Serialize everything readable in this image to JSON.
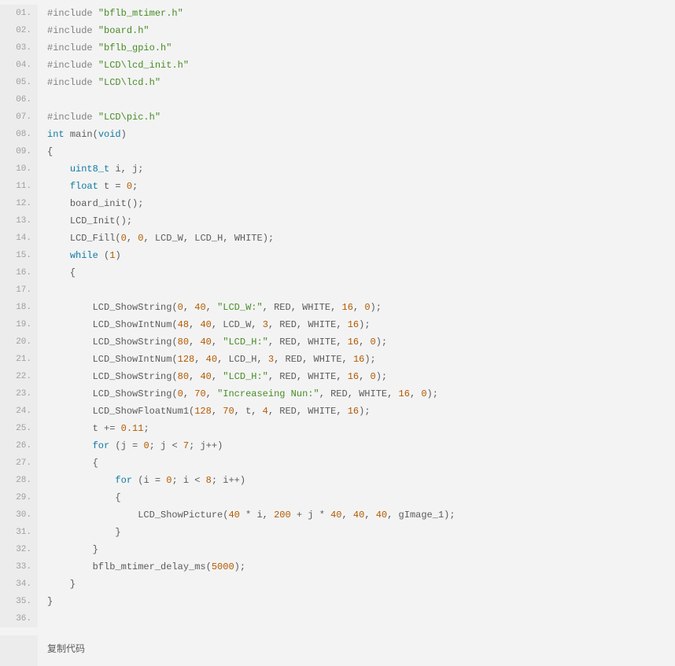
{
  "copy_label": "复制代码",
  "lines": [
    {
      "n": "01.",
      "t": [
        [
          "builtin",
          "#include"
        ],
        [
          "punc",
          " "
        ],
        [
          "string",
          "\"bflb_mtimer.h\""
        ]
      ]
    },
    {
      "n": "02.",
      "t": [
        [
          "builtin",
          "#include"
        ],
        [
          "punc",
          " "
        ],
        [
          "string",
          "\"board.h\""
        ]
      ]
    },
    {
      "n": "03.",
      "t": [
        [
          "builtin",
          "#include"
        ],
        [
          "punc",
          " "
        ],
        [
          "string",
          "\"bflb_gpio.h\""
        ]
      ]
    },
    {
      "n": "04.",
      "t": [
        [
          "builtin",
          "#include"
        ],
        [
          "punc",
          " "
        ],
        [
          "string",
          "\"LCD\\lcd_init.h\""
        ]
      ]
    },
    {
      "n": "05.",
      "t": [
        [
          "builtin",
          "#include"
        ],
        [
          "punc",
          " "
        ],
        [
          "string",
          "\"LCD\\lcd.h\""
        ]
      ]
    },
    {
      "n": "06.",
      "t": []
    },
    {
      "n": "07.",
      "t": [
        [
          "builtin",
          "#include"
        ],
        [
          "punc",
          " "
        ],
        [
          "string",
          "\"LCD\\pic.h\""
        ]
      ]
    },
    {
      "n": "08.",
      "t": [
        [
          "keyword",
          "int"
        ],
        [
          "punc",
          " "
        ],
        [
          "ident",
          "main"
        ],
        [
          "punc",
          "("
        ],
        [
          "keyword",
          "void"
        ],
        [
          "punc",
          ")"
        ]
      ]
    },
    {
      "n": "09.",
      "t": [
        [
          "punc",
          "{"
        ]
      ]
    },
    {
      "n": "10.",
      "t": [
        [
          "punc",
          "    "
        ],
        [
          "type",
          "uint8_t"
        ],
        [
          "punc",
          " "
        ],
        [
          "ident",
          "i"
        ],
        [
          "punc",
          ", "
        ],
        [
          "ident",
          "j"
        ],
        [
          "punc",
          ";"
        ]
      ]
    },
    {
      "n": "11.",
      "t": [
        [
          "punc",
          "    "
        ],
        [
          "keyword",
          "float"
        ],
        [
          "punc",
          " "
        ],
        [
          "ident",
          "t"
        ],
        [
          "punc",
          " = "
        ],
        [
          "number",
          "0"
        ],
        [
          "punc",
          ";"
        ]
      ]
    },
    {
      "n": "12.",
      "t": [
        [
          "punc",
          "    "
        ],
        [
          "ident",
          "board_init"
        ],
        [
          "punc",
          "();"
        ]
      ]
    },
    {
      "n": "13.",
      "t": [
        [
          "punc",
          "    "
        ],
        [
          "ident",
          "LCD_Init"
        ],
        [
          "punc",
          "();"
        ]
      ]
    },
    {
      "n": "14.",
      "t": [
        [
          "punc",
          "    "
        ],
        [
          "ident",
          "LCD_Fill"
        ],
        [
          "punc",
          "("
        ],
        [
          "number",
          "0"
        ],
        [
          "punc",
          ", "
        ],
        [
          "number",
          "0"
        ],
        [
          "punc",
          ", "
        ],
        [
          "ident",
          "LCD_W"
        ],
        [
          "punc",
          ", "
        ],
        [
          "ident",
          "LCD_H"
        ],
        [
          "punc",
          ", "
        ],
        [
          "ident",
          "WHITE"
        ],
        [
          "punc",
          ");"
        ]
      ]
    },
    {
      "n": "15.",
      "t": [
        [
          "punc",
          "    "
        ],
        [
          "keyword",
          "while"
        ],
        [
          "punc",
          " ("
        ],
        [
          "number",
          "1"
        ],
        [
          "punc",
          ")"
        ]
      ]
    },
    {
      "n": "16.",
      "t": [
        [
          "punc",
          "    {"
        ]
      ]
    },
    {
      "n": "17.",
      "t": []
    },
    {
      "n": "18.",
      "t": [
        [
          "punc",
          "        "
        ],
        [
          "ident",
          "LCD_ShowString"
        ],
        [
          "punc",
          "("
        ],
        [
          "number",
          "0"
        ],
        [
          "punc",
          ", "
        ],
        [
          "number",
          "40"
        ],
        [
          "punc",
          ", "
        ],
        [
          "string",
          "\"LCD_W:\""
        ],
        [
          "punc",
          ", "
        ],
        [
          "ident",
          "RED"
        ],
        [
          "punc",
          ", "
        ],
        [
          "ident",
          "WHITE"
        ],
        [
          "punc",
          ", "
        ],
        [
          "number",
          "16"
        ],
        [
          "punc",
          ", "
        ],
        [
          "number",
          "0"
        ],
        [
          "punc",
          ");"
        ]
      ]
    },
    {
      "n": "19.",
      "t": [
        [
          "punc",
          "        "
        ],
        [
          "ident",
          "LCD_ShowIntNum"
        ],
        [
          "punc",
          "("
        ],
        [
          "number",
          "48"
        ],
        [
          "punc",
          ", "
        ],
        [
          "number",
          "40"
        ],
        [
          "punc",
          ", "
        ],
        [
          "ident",
          "LCD_W"
        ],
        [
          "punc",
          ", "
        ],
        [
          "number",
          "3"
        ],
        [
          "punc",
          ", "
        ],
        [
          "ident",
          "RED"
        ],
        [
          "punc",
          ", "
        ],
        [
          "ident",
          "WHITE"
        ],
        [
          "punc",
          ", "
        ],
        [
          "number",
          "16"
        ],
        [
          "punc",
          ");"
        ]
      ]
    },
    {
      "n": "20.",
      "t": [
        [
          "punc",
          "        "
        ],
        [
          "ident",
          "LCD_ShowString"
        ],
        [
          "punc",
          "("
        ],
        [
          "number",
          "80"
        ],
        [
          "punc",
          ", "
        ],
        [
          "number",
          "40"
        ],
        [
          "punc",
          ", "
        ],
        [
          "string",
          "\"LCD_H:\""
        ],
        [
          "punc",
          ", "
        ],
        [
          "ident",
          "RED"
        ],
        [
          "punc",
          ", "
        ],
        [
          "ident",
          "WHITE"
        ],
        [
          "punc",
          ", "
        ],
        [
          "number",
          "16"
        ],
        [
          "punc",
          ", "
        ],
        [
          "number",
          "0"
        ],
        [
          "punc",
          ");"
        ]
      ]
    },
    {
      "n": "21.",
      "t": [
        [
          "punc",
          "        "
        ],
        [
          "ident",
          "LCD_ShowIntNum"
        ],
        [
          "punc",
          "("
        ],
        [
          "number",
          "128"
        ],
        [
          "punc",
          ", "
        ],
        [
          "number",
          "40"
        ],
        [
          "punc",
          ", "
        ],
        [
          "ident",
          "LCD_H"
        ],
        [
          "punc",
          ", "
        ],
        [
          "number",
          "3"
        ],
        [
          "punc",
          ", "
        ],
        [
          "ident",
          "RED"
        ],
        [
          "punc",
          ", "
        ],
        [
          "ident",
          "WHITE"
        ],
        [
          "punc",
          ", "
        ],
        [
          "number",
          "16"
        ],
        [
          "punc",
          ");"
        ]
      ]
    },
    {
      "n": "22.",
      "t": [
        [
          "punc",
          "        "
        ],
        [
          "ident",
          "LCD_ShowString"
        ],
        [
          "punc",
          "("
        ],
        [
          "number",
          "80"
        ],
        [
          "punc",
          ", "
        ],
        [
          "number",
          "40"
        ],
        [
          "punc",
          ", "
        ],
        [
          "string",
          "\"LCD_H:\""
        ],
        [
          "punc",
          ", "
        ],
        [
          "ident",
          "RED"
        ],
        [
          "punc",
          ", "
        ],
        [
          "ident",
          "WHITE"
        ],
        [
          "punc",
          ", "
        ],
        [
          "number",
          "16"
        ],
        [
          "punc",
          ", "
        ],
        [
          "number",
          "0"
        ],
        [
          "punc",
          ");"
        ]
      ]
    },
    {
      "n": "23.",
      "t": [
        [
          "punc",
          "        "
        ],
        [
          "ident",
          "LCD_ShowString"
        ],
        [
          "punc",
          "("
        ],
        [
          "number",
          "0"
        ],
        [
          "punc",
          ", "
        ],
        [
          "number",
          "70"
        ],
        [
          "punc",
          ", "
        ],
        [
          "string",
          "\"Increaseing Nun:\""
        ],
        [
          "punc",
          ", "
        ],
        [
          "ident",
          "RED"
        ],
        [
          "punc",
          ", "
        ],
        [
          "ident",
          "WHITE"
        ],
        [
          "punc",
          ", "
        ],
        [
          "number",
          "16"
        ],
        [
          "punc",
          ", "
        ],
        [
          "number",
          "0"
        ],
        [
          "punc",
          ");"
        ]
      ]
    },
    {
      "n": "24.",
      "t": [
        [
          "punc",
          "        "
        ],
        [
          "ident",
          "LCD_ShowFloatNum1"
        ],
        [
          "punc",
          "("
        ],
        [
          "number",
          "128"
        ],
        [
          "punc",
          ", "
        ],
        [
          "number",
          "70"
        ],
        [
          "punc",
          ", "
        ],
        [
          "ident",
          "t"
        ],
        [
          "punc",
          ", "
        ],
        [
          "number",
          "4"
        ],
        [
          "punc",
          ", "
        ],
        [
          "ident",
          "RED"
        ],
        [
          "punc",
          ", "
        ],
        [
          "ident",
          "WHITE"
        ],
        [
          "punc",
          ", "
        ],
        [
          "number",
          "16"
        ],
        [
          "punc",
          ");"
        ]
      ]
    },
    {
      "n": "25.",
      "t": [
        [
          "punc",
          "        "
        ],
        [
          "ident",
          "t"
        ],
        [
          "punc",
          " += "
        ],
        [
          "number",
          "0.11"
        ],
        [
          "punc",
          ";"
        ]
      ]
    },
    {
      "n": "26.",
      "t": [
        [
          "punc",
          "        "
        ],
        [
          "keyword",
          "for"
        ],
        [
          "punc",
          " ("
        ],
        [
          "ident",
          "j"
        ],
        [
          "punc",
          " = "
        ],
        [
          "number",
          "0"
        ],
        [
          "punc",
          "; "
        ],
        [
          "ident",
          "j"
        ],
        [
          "punc",
          " < "
        ],
        [
          "number",
          "7"
        ],
        [
          "punc",
          "; "
        ],
        [
          "ident",
          "j"
        ],
        [
          "punc",
          "++)"
        ]
      ]
    },
    {
      "n": "27.",
      "t": [
        [
          "punc",
          "        {"
        ]
      ]
    },
    {
      "n": "28.",
      "t": [
        [
          "punc",
          "            "
        ],
        [
          "keyword",
          "for"
        ],
        [
          "punc",
          " ("
        ],
        [
          "ident",
          "i"
        ],
        [
          "punc",
          " = "
        ],
        [
          "number",
          "0"
        ],
        [
          "punc",
          "; "
        ],
        [
          "ident",
          "i"
        ],
        [
          "punc",
          " < "
        ],
        [
          "number",
          "8"
        ],
        [
          "punc",
          "; "
        ],
        [
          "ident",
          "i"
        ],
        [
          "punc",
          "++)"
        ]
      ]
    },
    {
      "n": "29.",
      "t": [
        [
          "punc",
          "            {"
        ]
      ]
    },
    {
      "n": "30.",
      "t": [
        [
          "punc",
          "                "
        ],
        [
          "ident",
          "LCD_ShowPicture"
        ],
        [
          "punc",
          "("
        ],
        [
          "number",
          "40"
        ],
        [
          "punc",
          " * "
        ],
        [
          "ident",
          "i"
        ],
        [
          "punc",
          ", "
        ],
        [
          "number",
          "200"
        ],
        [
          "punc",
          " + "
        ],
        [
          "ident",
          "j"
        ],
        [
          "punc",
          " * "
        ],
        [
          "number",
          "40"
        ],
        [
          "punc",
          ", "
        ],
        [
          "number",
          "40"
        ],
        [
          "punc",
          ", "
        ],
        [
          "number",
          "40"
        ],
        [
          "punc",
          ", "
        ],
        [
          "ident",
          "gImage_1"
        ],
        [
          "punc",
          ");"
        ]
      ]
    },
    {
      "n": "31.",
      "t": [
        [
          "punc",
          "            }"
        ]
      ]
    },
    {
      "n": "32.",
      "t": [
        [
          "punc",
          "        }"
        ]
      ]
    },
    {
      "n": "33.",
      "t": [
        [
          "punc",
          "        "
        ],
        [
          "ident",
          "bflb_mtimer_delay_ms"
        ],
        [
          "punc",
          "("
        ],
        [
          "number",
          "5000"
        ],
        [
          "punc",
          ");"
        ]
      ]
    },
    {
      "n": "34.",
      "t": [
        [
          "punc",
          "    }"
        ]
      ]
    },
    {
      "n": "35.",
      "t": [
        [
          "punc",
          "}"
        ]
      ]
    },
    {
      "n": "36.",
      "t": []
    }
  ]
}
